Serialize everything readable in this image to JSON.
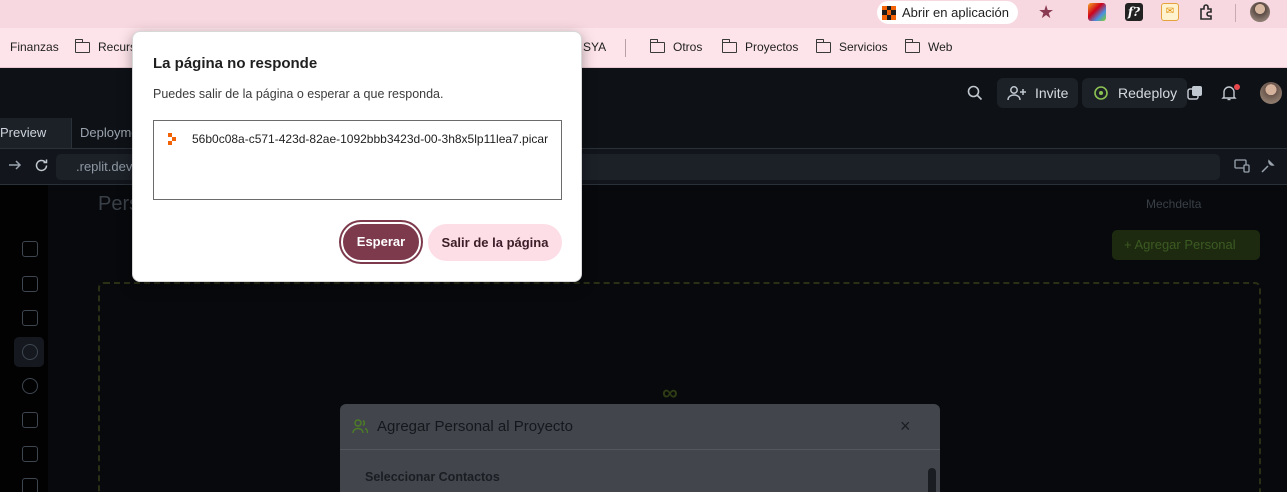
{
  "browser": {
    "app_chip_label": "Abrir en aplicación",
    "bookmarks": [
      "Finanzas",
      "Recursos",
      "SYA",
      "Otros",
      "Proyectos",
      "Servicios",
      "Web"
    ],
    "ext_2_glyph": "f?",
    "ext_3_glyph": "✉"
  },
  "replit": {
    "invite_label": "Invite",
    "redeploy_label": "Redeploy",
    "tabs": [
      "Preview",
      "Deployments"
    ],
    "url_text": ".replit.dev",
    "page_title": "Personal",
    "dropdown_label": "Mechdelta",
    "add_button_label": "+ Agregar Personal",
    "modal_title": "Agregar Personal al Proyecto",
    "modal_label": "Seleccionar Contactos",
    "modal_close": "×"
  },
  "dialog": {
    "title": "La página no responde",
    "description": "Puedes salir de la página o esperar a que responda.",
    "items": [
      "56b0c08a-c571-423d-82ae-1092bbb3423d-00-3h8x5lp11lea7.picar"
    ],
    "wait_label": "Esperar",
    "leave_label": "Salir de la página"
  },
  "colors": {
    "chrome_bar": "#f8d8e0",
    "bookmark_bar": "#fde4ea",
    "primary_button": "#7c3a4c",
    "secondary_button": "#fddde6",
    "app_bg": "#0e1116"
  }
}
